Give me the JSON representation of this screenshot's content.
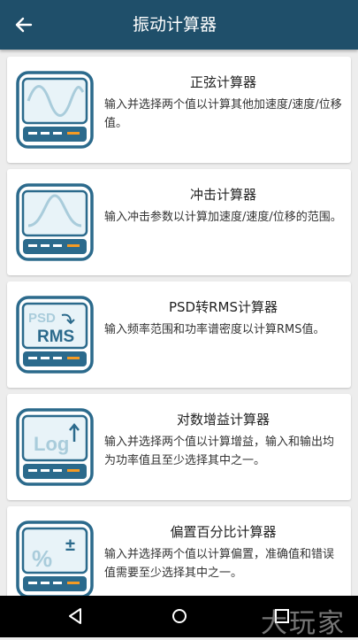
{
  "app": {
    "title": "振动计算器"
  },
  "cards": [
    {
      "title": "正弦计算器",
      "desc": "输入并选择两个值以计算其他加速度/速度/位移值。",
      "icon": "sine-wave-icon"
    },
    {
      "title": "冲击计算器",
      "desc": "输入冲击参数以计算加速度/速度/位移的范围。",
      "icon": "shock-pulse-icon"
    },
    {
      "title": "PSD转RMS计算器",
      "desc": "输入频率范围和功率谱密度以计算RMS值。",
      "icon": "psd-rms-icon",
      "icon_text_top": "PSD",
      "icon_text_bottom": "RMS"
    },
    {
      "title": "对数增益计算器",
      "desc": "输入并选择两个值以计算增益，输入和输出均为功率值且至少选择其中之一。",
      "icon": "log-icon",
      "icon_text": "Log"
    },
    {
      "title": "偏置百分比计算器",
      "desc": "输入并选择两个值以计算偏置，准确值和错误值需要至少选择其中之一。",
      "icon": "percent-icon",
      "icon_text": "%",
      "icon_sup": "±"
    }
  ],
  "watermark": "大玩家",
  "colors": {
    "appbar": "#1f4f6a",
    "icon_frame": "#2b6a8c",
    "icon_screen": "#e8f3f8",
    "accent": "#f59a23"
  }
}
